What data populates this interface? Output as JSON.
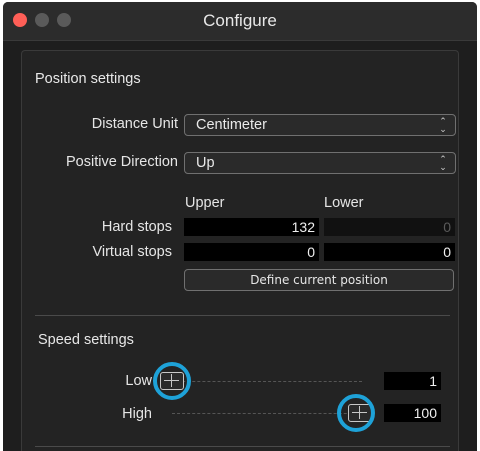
{
  "window": {
    "title": "Configure",
    "colors": {
      "close": "#ff5f57",
      "highlight": "#1ea2d8",
      "background": "#1e1e1e"
    }
  },
  "position": {
    "title": "Position settings",
    "distance_unit_label": "Distance Unit",
    "distance_unit_value": "Centimeter",
    "positive_direction_label": "Positive Direction",
    "positive_direction_value": "Up",
    "col_upper": "Upper",
    "col_lower": "Lower",
    "hard_stops_label": "Hard stops",
    "hard_upper": "132",
    "hard_lower": "0",
    "virtual_stops_label": "Virtual stops",
    "virtual_upper": "0",
    "virtual_lower": "0",
    "define_button": "Define current position"
  },
  "speed": {
    "title": "Speed settings",
    "low_label": "Low",
    "low_value": "1",
    "low_fraction": 0.0,
    "high_label": "High",
    "high_value": "100",
    "high_fraction": 1.0
  },
  "icons": {
    "select_arrows": "up-down-chevron-icon",
    "slider_thumb": "slider-thumb-icon",
    "highlight": "highlight-ring"
  }
}
